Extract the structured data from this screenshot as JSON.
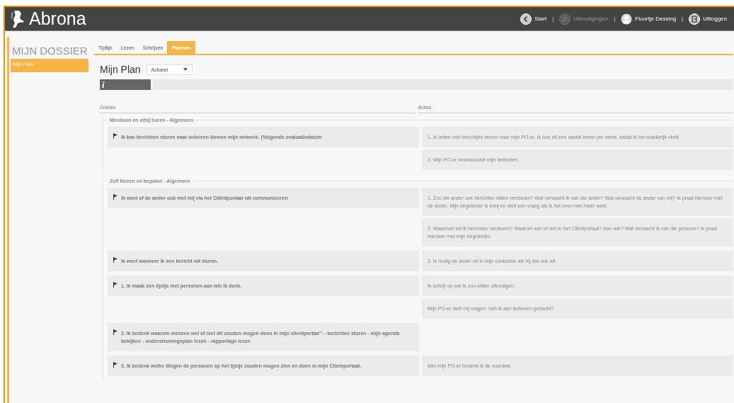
{
  "header": {
    "logo": "Abrona",
    "separator": "|",
    "nav": [
      {
        "kind": "start",
        "label": "Start",
        "disabled": false
      },
      {
        "kind": "invitations",
        "label": "Uitnodigingen",
        "disabled": true
      },
      {
        "kind": "user",
        "label": "Floortje Dessing",
        "disabled": false
      },
      {
        "kind": "logout",
        "label": "Uitloggen",
        "disabled": false
      }
    ]
  },
  "sidebar": {
    "title": "MIJN DOSSIER",
    "items": [
      {
        "label": "Mijn Plan",
        "selected": true
      }
    ]
  },
  "tabs": [
    {
      "label": "Tijdlijn",
      "selected": false
    },
    {
      "label": "Lezen",
      "selected": false
    },
    {
      "label": "Schrijven",
      "selected": false
    },
    {
      "label": "Plannen",
      "selected": true
    }
  ],
  "plan": {
    "title": "Mijn Plan",
    "filter": "Actueel",
    "info_icon": "i",
    "columns": [
      "Doelen",
      "Acties"
    ],
    "groups": [
      {
        "title": "Meedoen en erbij horen - Algemeen",
        "goals": [
          {
            "text": "Ik kan berichten sturen naar iedereen binnen mijn netwerk. (Volgende evaluatiedatum",
            "actions": [
              "1. Ik oefen met berichtjes sturen naar mijn PO-er. Ik doe dit een aantal keren per week, totdat ik het makkelijk vindt.",
              "2. Mijn PO-er beantwoordt mijn berichten."
            ]
          }
        ]
      },
      {
        "title": "Zelf kiezen en bepalen - Algemeen",
        "goals": [
          {
            "text": "Ik weet of de ander ook met mij via het Cliëntportaal wil communiceren",
            "actions": [
              "1. Zou die ander ook berichten willen versturen? Wat verwacht ik van die ander? Wat verwacht de ander van mij? Ik praat hierover met de ander. Mijn begeleider is erbij en stelt een vraag als ik het even niet meer weet.",
              "2. Waarover wil ik berichten versturen? Waarom wel of niet in het Cliëntportaal? Aan wie? Wat verwacht ik van die persoon? Ik praat hierover met mijn begeleider."
            ]
          },
          {
            "text": "Ik weet wanneer ik een bericht wil sturen.",
            "actions": [
              "3. Ik nodig de ander uit in mijn contacten als hij dat ook wil."
            ]
          },
          {
            "text": "1. Ik maak een lijstje met personen aan wie ik denk.",
            "actions": [
              "Ik schrijf op wie ik zou willen uitnodigen.",
              "Mijn PO-er stelt mij vragen: heb ik aan iedereen gedacht?"
            ]
          },
          {
            "text": "2. Ik bedenk waarom mensen wel of niet dit zouden mogen doen in mijn clientportaa\": - berichten sturen - mijn agenda bekijken - ondersteuningsplan lezen - rapportage lezen"
          },
          {
            "text": "3. Ik bedenk welke dingen de personen op het lijstje zouden mogen zien en doen in mijn Clientportaal.",
            "actions": [
              "Met mijn PO-er bedenk ik de voordele"
            ]
          }
        ]
      }
    ]
  }
}
